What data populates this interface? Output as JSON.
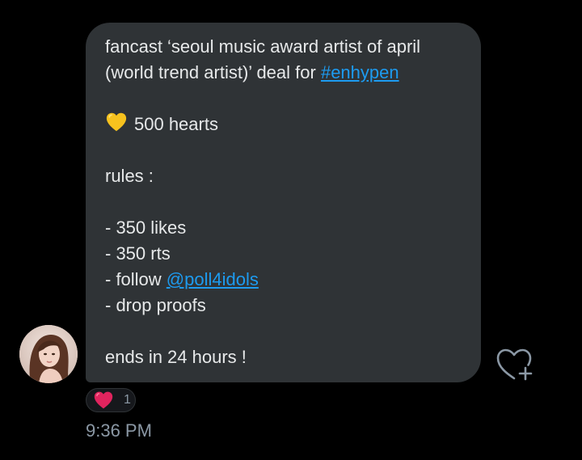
{
  "message": {
    "line1": "fancast ‘seoul music award artist of april",
    "line2_text": "(world trend artist)’ deal for ",
    "line2_link": "#enhypen",
    "hearts_text": "500 hearts",
    "hearts_emoji": "yellow-heart-icon",
    "rules_title": "rules :",
    "rule1": "- 350 likes",
    "rule2": "- 350 rts",
    "rule3_text": "- follow ",
    "rule3_link": "@poll4idols",
    "rule4": "- drop proofs",
    "ending": "ends in 24 hours !"
  },
  "reaction": {
    "icon": "red-heart-icon",
    "count": "1"
  },
  "timestamp": "9:36 PM",
  "colors": {
    "background": "#000000",
    "bubble": "#2f3336",
    "text": "#e7e9ea",
    "link": "#1d9bf0",
    "muted": "#8b98a5",
    "yellow_heart": "#f7c21e",
    "red_heart": "#e0245e"
  },
  "icons": {
    "like_button": "heart-plus-icon",
    "avatar": "avatar"
  }
}
